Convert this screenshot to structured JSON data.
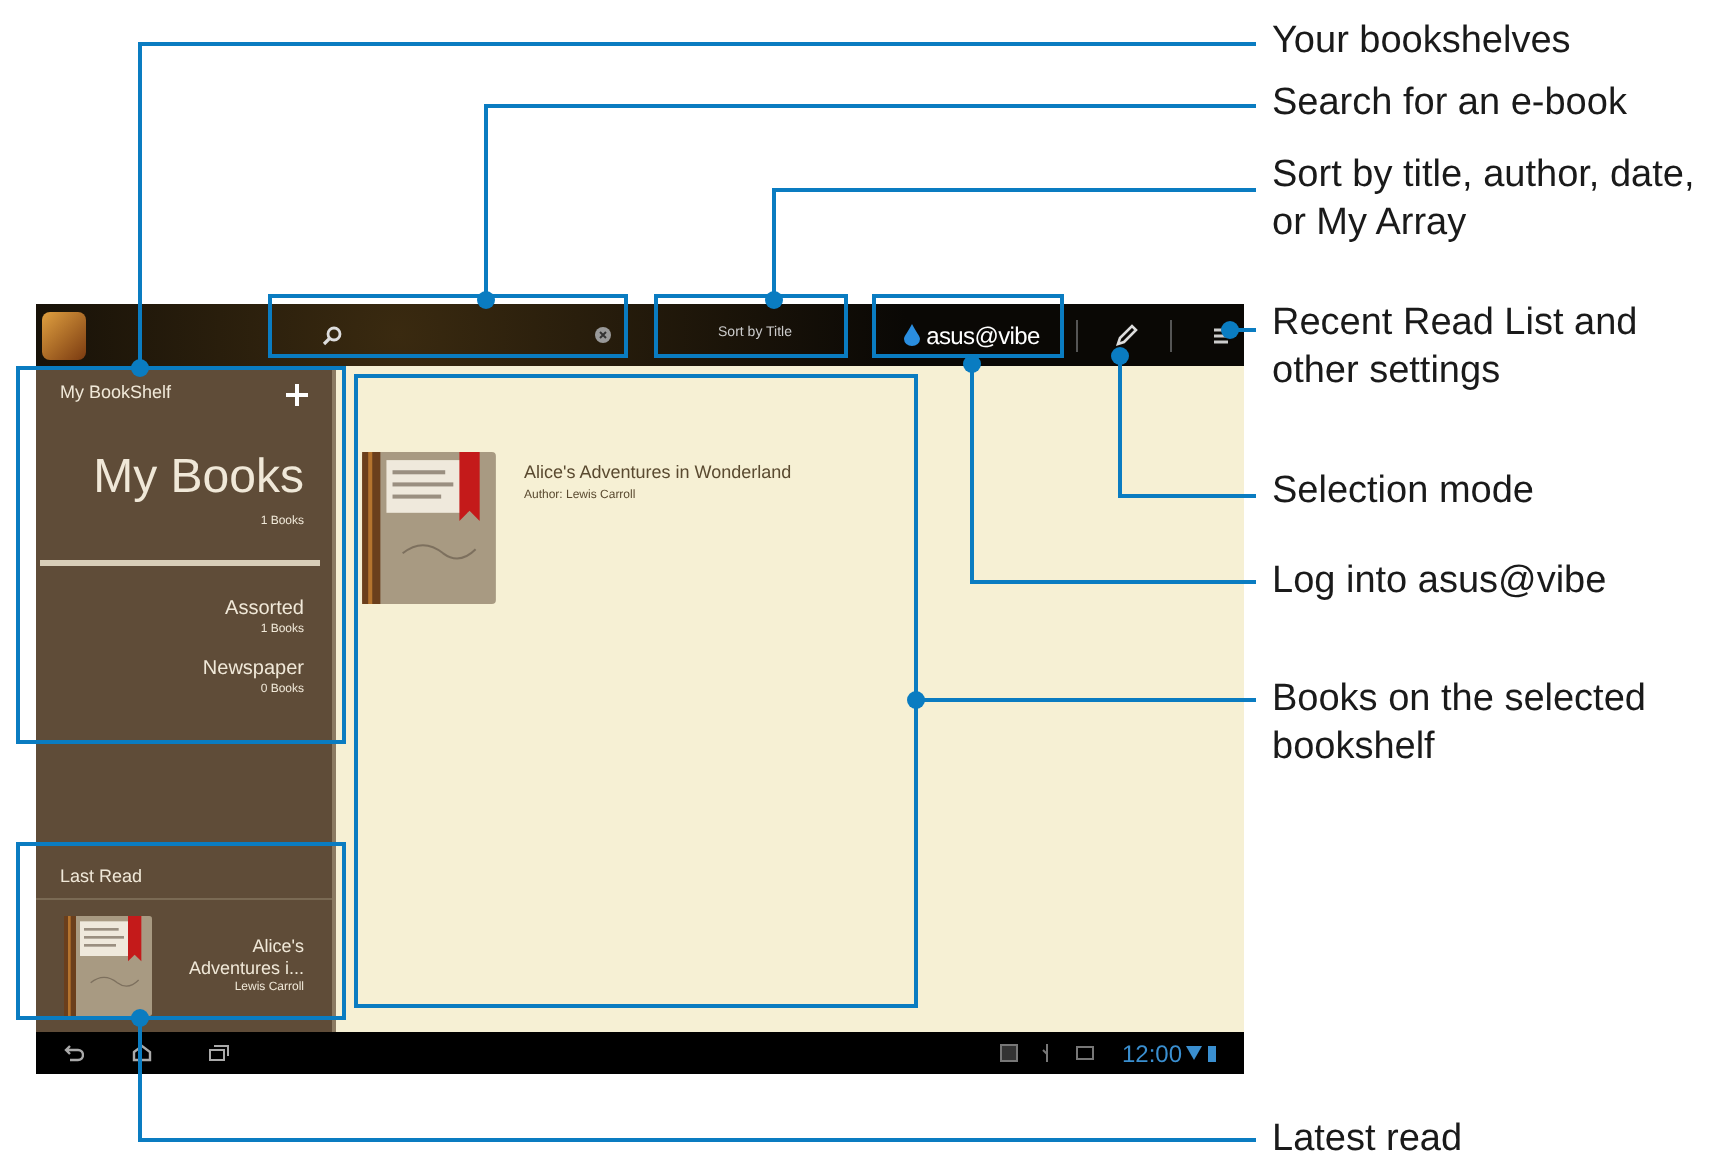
{
  "callouts": [
    {
      "label": "Your bookshelves"
    },
    {
      "label": "Search for an e-book"
    },
    {
      "label": "Sort by title, author, date, or My Array"
    },
    {
      "label": "Recent Read List and other settings"
    },
    {
      "label": "Selection mode"
    },
    {
      "label": "Log into asus@vibe"
    },
    {
      "label": "Books on the selected bookshelf"
    },
    {
      "label": "Latest read"
    }
  ],
  "top_bar": {
    "sort_button": "Sort by Title",
    "vibe_logo": "asus@vibe"
  },
  "sidebar": {
    "title": "My BookShelf",
    "main_shelf": {
      "name": "My Books",
      "count": "1 Books"
    },
    "shelves": [
      {
        "name": "Assorted",
        "count": "1 Books"
      },
      {
        "name": "Newspaper",
        "count": "0 Books"
      }
    ],
    "last_read": {
      "heading": "Last Read",
      "title": "Alice's Adventures i...",
      "author": "Lewis Carroll"
    }
  },
  "books": [
    {
      "title": "Alice's Adventures in Wonderland",
      "author": "Author: Lewis Carroll"
    }
  ],
  "status_bar": {
    "time": "12:00"
  }
}
